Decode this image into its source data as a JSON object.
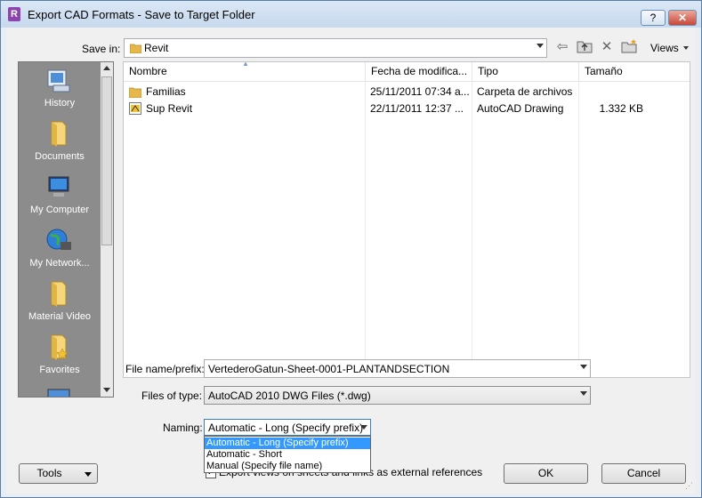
{
  "window": {
    "title": "Export CAD Formats - Save to Target Folder",
    "app_icon_letter": "R",
    "help_label": "?",
    "close_label": "✕"
  },
  "toolbar": {
    "save_in_label": "Save in:",
    "save_in_value": "Revit",
    "views_label": "Views"
  },
  "places": [
    {
      "label": "History",
      "icon": "history-icon"
    },
    {
      "label": "Documents",
      "icon": "documents-folder-icon"
    },
    {
      "label": "My Computer",
      "icon": "my-computer-icon"
    },
    {
      "label": "My Network...",
      "icon": "network-globe-icon"
    },
    {
      "label": "Material Video",
      "icon": "folder-icon"
    },
    {
      "label": "Favorites",
      "icon": "favorites-folder-icon"
    }
  ],
  "file_list": {
    "columns": [
      "Nombre",
      "Fecha de modifica...",
      "Tipo",
      "Tamaño"
    ],
    "rows": [
      {
        "name": "Familias",
        "date": "25/11/2011 07:34 a...",
        "type": "Carpeta de archivos",
        "size": "",
        "icon": "folder-icon"
      },
      {
        "name": "Sup Revit",
        "date": "22/11/2011 12:37 ...",
        "type": "AutoCAD Drawing",
        "size": "1.332 KB",
        "icon": "dwg-file-icon"
      }
    ]
  },
  "form": {
    "file_name_label": "File name/prefix:",
    "file_name_value": "VertederoGatun-Sheet-0001-PLANTANDSECTION",
    "files_of_type_label": "Files of type:",
    "files_of_type_value": "AutoCAD 2010 DWG Files  (*.dwg)",
    "naming_label": "Naming:",
    "naming_value": "Automatic - Long (Specify prefix)",
    "naming_options": [
      "Automatic - Long (Specify prefix)",
      "Automatic - Short",
      "Manual (Specify file name)"
    ],
    "export_views_label": "Export views on sheets and links as external references"
  },
  "buttons": {
    "tools": "Tools",
    "ok": "OK",
    "cancel": "Cancel"
  }
}
